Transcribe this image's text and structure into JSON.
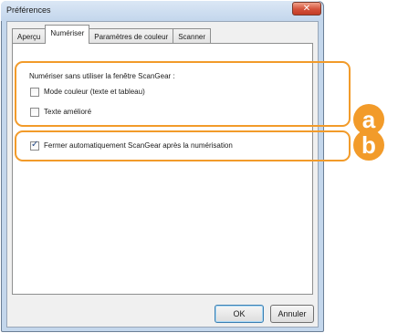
{
  "window": {
    "title": "Préférences",
    "close_label": "✕"
  },
  "tabs": [
    {
      "label": "Aperçu"
    },
    {
      "label": "Numériser"
    },
    {
      "label": "Paramètres de couleur"
    },
    {
      "label": "Scanner"
    }
  ],
  "active_tab": "Numériser",
  "group_a": {
    "heading": "Numériser sans utiliser la fenêtre ScanGear :",
    "options": [
      {
        "label": "Mode couleur (texte et tableau)",
        "checked": false
      },
      {
        "label": "Texte amélioré",
        "checked": false
      }
    ]
  },
  "group_b": {
    "option": {
      "label": "Fermer automatiquement ScanGear après la numérisation",
      "checked": true
    }
  },
  "callouts": {
    "a": "a",
    "b": "b"
  },
  "buttons": {
    "ok": "OK",
    "cancel": "Annuler"
  },
  "colors": {
    "callout": "#f29b2a",
    "close_button": "#d3513a"
  }
}
